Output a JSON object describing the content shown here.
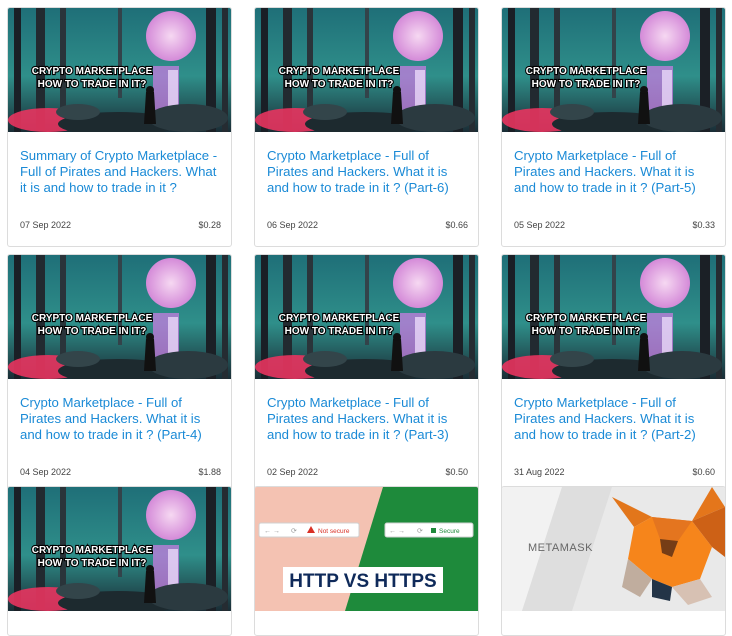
{
  "thumb_text": {
    "crypto_line1": "CRYPTO MARKETPLACE",
    "crypto_line2": "HOW TO TRADE IN IT?",
    "http_title": "HTTP VS HTTPS",
    "not_secure": "Not secure",
    "secure": "Secure",
    "metamask": "METAMASK"
  },
  "posts": [
    {
      "title": "Summary of Crypto Marketplace - Full of Pirates and Hackers. What it is and how to trade in it ?",
      "date": "07 Sep 2022",
      "payout": "$0.28"
    },
    {
      "title": "Crypto Marketplace - Full of Pirates and Hackers. What it is and how to trade in it ? (Part-6)",
      "date": "06 Sep 2022",
      "payout": "$0.66"
    },
    {
      "title": "Crypto Marketplace - Full of Pirates and Hackers. What it is and how to trade in it ? (Part-5)",
      "date": "05 Sep 2022",
      "payout": "$0.33"
    },
    {
      "title": "Crypto Marketplace - Full of Pirates and Hackers. What it is and how to trade in it ? (Part-4)",
      "date": "04 Sep 2022",
      "payout": "$1.88"
    },
    {
      "title": "Crypto Marketplace - Full of Pirates and Hackers. What it is and how to trade in it ? (Part-3)",
      "date": "02 Sep 2022",
      "payout": "$0.50"
    },
    {
      "title": "Crypto Marketplace - Full of Pirates and Hackers. What it is and how to trade in it ? (Part-2)",
      "date": "31 Aug 2022",
      "payout": "$0.60"
    }
  ],
  "colors": {
    "title_link": "#1a8ad6",
    "http_green": "#1e8a3b",
    "http_pink": "#f4c2b2",
    "http_navy": "#0f2a5a"
  }
}
